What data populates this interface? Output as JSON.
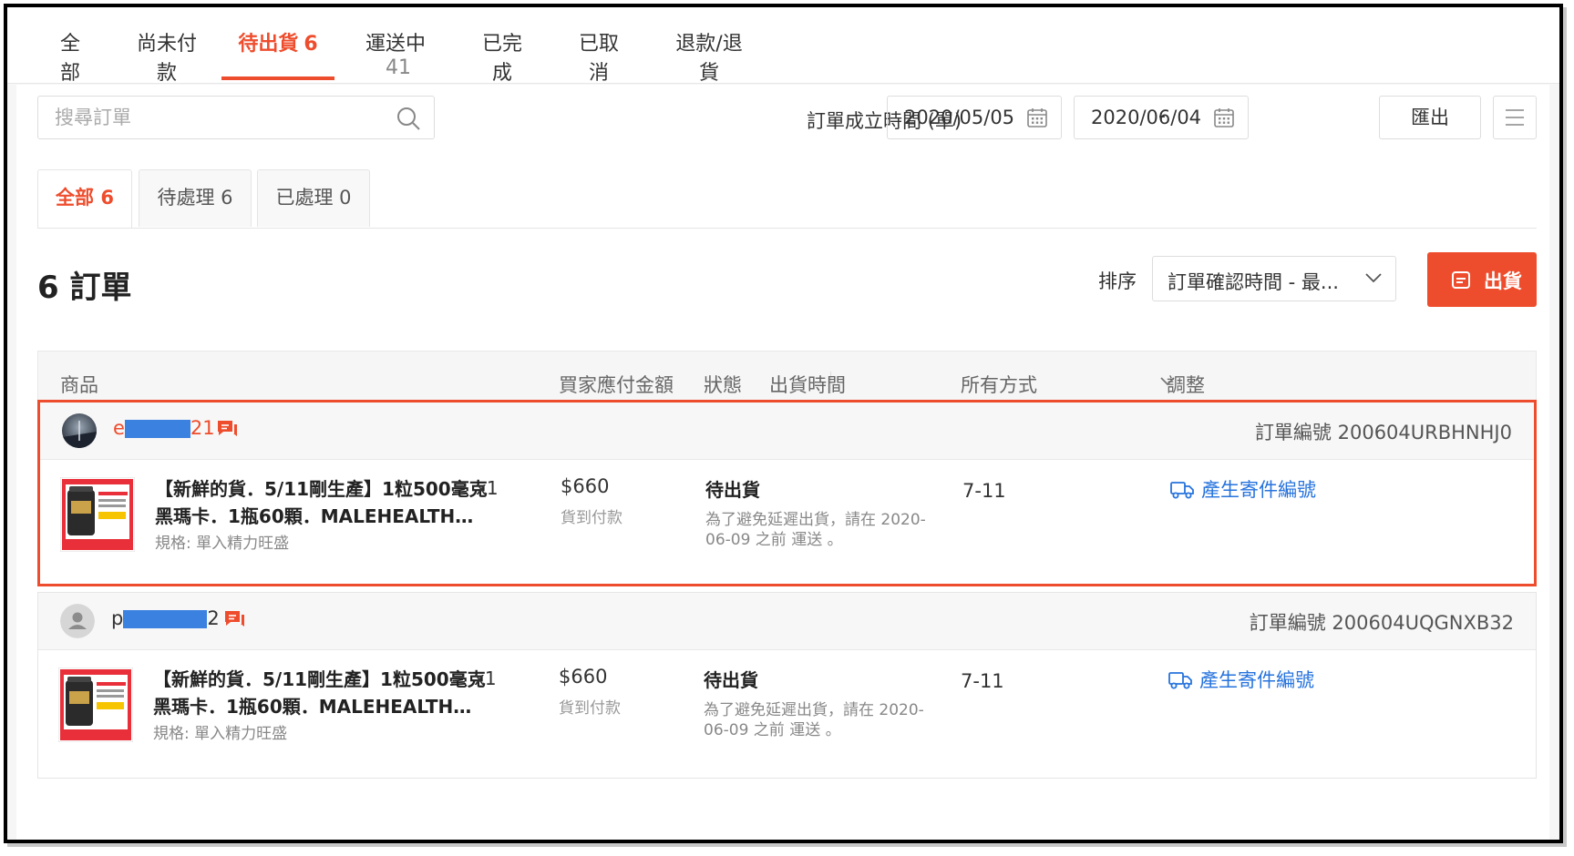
{
  "colors": {
    "accent": "#ee4d2d",
    "link": "#2673dd",
    "redact": "#3b82e0"
  },
  "top_tabs": [
    {
      "label": "全部",
      "count": ""
    },
    {
      "label": "尚未付款",
      "count": ""
    },
    {
      "label": "待出貨",
      "count": "6",
      "active": true
    },
    {
      "label": "運送中",
      "count": "41"
    },
    {
      "label": "已完成",
      "count": ""
    },
    {
      "label": "已取消",
      "count": ""
    },
    {
      "label": "退款/退貨",
      "count": ""
    }
  ],
  "search": {
    "placeholder": "搜尋訂單",
    "icon": "search-icon"
  },
  "date_filter": {
    "label": "訂單成立時間 (單)",
    "start": "2020/05/05",
    "separator": "-",
    "end": "2020/06/04",
    "icon": "calendar-icon"
  },
  "toolbar": {
    "export_label": "匯出",
    "menu_icon": "menu-icon"
  },
  "sub_tabs": [
    {
      "label": "全部 6",
      "active": true
    },
    {
      "label": "待處理 6"
    },
    {
      "label": "已處理 0"
    }
  ],
  "summary": {
    "title": "6 訂單"
  },
  "sort": {
    "label": "排序",
    "value": "訂單確認時間 - 最..."
  },
  "ship_button": {
    "label": "出貨",
    "icon": "ship-print-icon"
  },
  "table_header": {
    "product": "商品",
    "amount": "買家應付金額",
    "status": "狀態",
    "ship_time": "出貨時間",
    "method": "所有方式",
    "action": "調整"
  },
  "orders": [
    {
      "buyer_prefix": "e",
      "buyer_suffix": "21",
      "order_no": "訂單編號 200604URBHNHJ0",
      "product_line1": "【新鮮的貨．5/11剛生產】1粒500毫克",
      "product_line2": "黑瑪卡．1瓶60顆．MALEHEALTH瑪...",
      "qty": "x1",
      "spec": "規格: 單入精力旺盛",
      "price": "$660",
      "payment": "貨到付款",
      "status": "待出貨",
      "note": "為了避免延遲出貨，請在 2020-06-09 之前 運送 。",
      "carrier": "7-11",
      "action": "產生寄件編號"
    },
    {
      "buyer_prefix": "p",
      "buyer_suffix": "2",
      "order_no": "訂單編號 200604UQGNXB32",
      "product_line1": "【新鮮的貨．5/11剛生產】1粒500毫克",
      "product_line2": "黑瑪卡．1瓶60顆．MALEHEALTH瑪...",
      "qty": "x1",
      "spec": "規格: 單入精力旺盛",
      "price": "$660",
      "payment": "貨到付款",
      "status": "待出貨",
      "note": "為了避免延遲出貨，請在 2020-06-09 之前 運送 。",
      "carrier": "7-11",
      "action": "產生寄件編號"
    }
  ]
}
